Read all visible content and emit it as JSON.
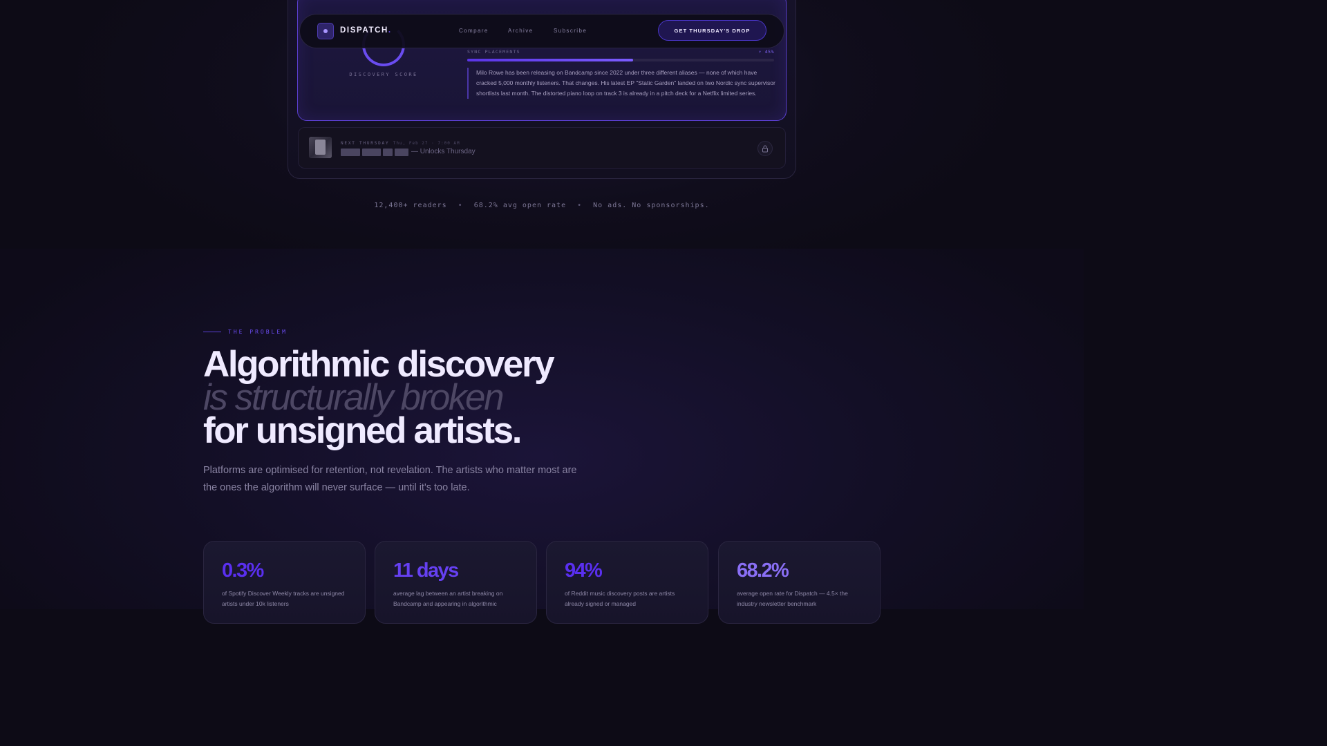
{
  "nav": {
    "brand": "DISPATCH",
    "brand_dot": ".",
    "links": [
      "Compare",
      "Archive",
      "Subscribe"
    ],
    "cta": "GET THURSDAY'S DROP"
  },
  "preview": {
    "score_label": "DISCOVERY SCORE",
    "sync_label": "SYNC PLACEMENTS",
    "sync_value": "↑ 45%",
    "sync_progress": 0.54,
    "blurb": "Milo Rowe has been releasing on Bandcamp since 2022 under three different aliases — none of which have cracked 5,000 monthly listeners. That changes. His latest EP \"Static Garden\" landed on two Nordic sync supervisor shortlists last month. The distorted piano loop on track 3 is already in a pitch deck for a Netflix limited series.",
    "next_label": "NEXT THURSDAY",
    "next_date": "Thu, Feb 27 · 7:00 AM",
    "unlocks": "— Unlocks Thursday"
  },
  "stats_line": {
    "readers": "12,400+ readers",
    "open_rate": "68.2% avg open rate",
    "policy": "No ads. No sponsorships.",
    "separator": "•"
  },
  "problem": {
    "eyebrow": "THE PROBLEM",
    "headline_1": "Algorithmic discovery",
    "headline_2": "is structurally broken",
    "headline_3": "for unsigned artists.",
    "subtext": "Platforms are optimised for retention, not revelation. The artists who matter most are the ones the algorithm will never surface — until it's too late."
  },
  "cards": [
    {
      "value": "0.3%",
      "desc": "of Spotify Discover Weekly tracks are unsigned artists under 10k listeners",
      "color": "#5a2ff0"
    },
    {
      "value": "11 days",
      "desc": "average lag between an artist breaking on Bandcamp and appearing in algorithmic",
      "color": "#6640f2"
    },
    {
      "value": "94%",
      "desc": "of Reddit music discovery posts are artists already signed or managed",
      "color": "#5a2ff0"
    },
    {
      "value": "68.2%",
      "desc": "average open rate for Dispatch — 4.5× the industry newsletter benchmark",
      "color": "#8a6ff5"
    }
  ],
  "colors": {
    "accent": "#6a4cf0",
    "background": "#0d0b16"
  }
}
